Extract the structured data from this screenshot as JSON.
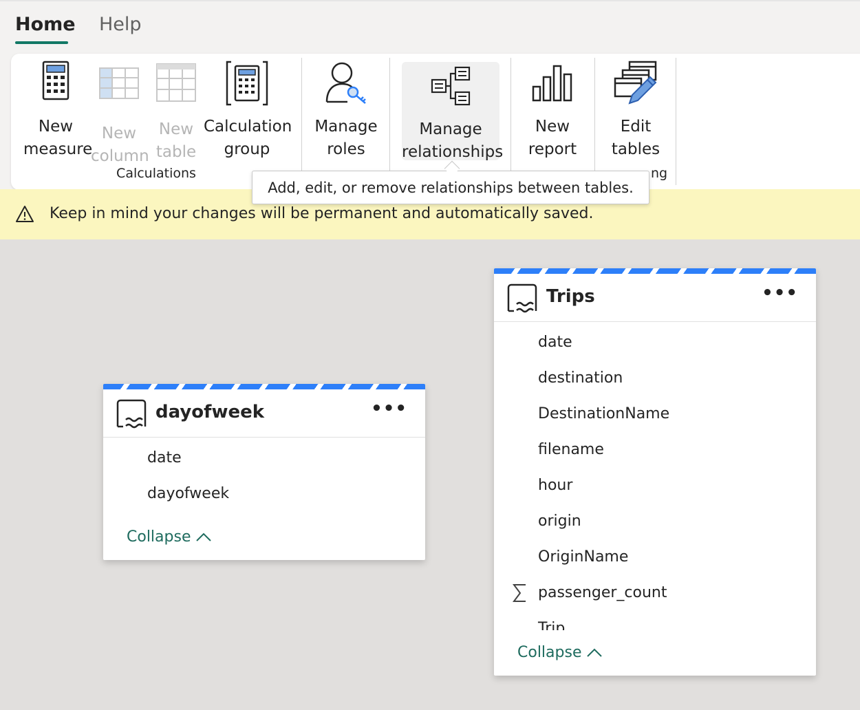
{
  "tabs": [
    {
      "label": "Home",
      "active": true
    },
    {
      "label": "Help",
      "active": false
    }
  ],
  "ribbon": {
    "new_measure": "New measure",
    "new_measure_l1": "New",
    "new_measure_l2": "measure",
    "new_column_l1": "New",
    "new_column_l2": "column",
    "new_table_l1": "New",
    "new_table_l2": "table",
    "calc_group_l1": "Calculation",
    "calc_group_l2": "group",
    "manage_roles_l1": "Manage",
    "manage_roles_l2": "roles",
    "manage_rel_l1": "Manage",
    "manage_rel_l2": "relationships",
    "new_report_l1": "New",
    "new_report_l2": "report",
    "edit_tables_l1": "Edit",
    "edit_tables_l2": "tables",
    "group_calculations": "Calculations",
    "group_modeling_partial": "ng"
  },
  "tooltip": "Add, edit, or remove relationships between tables.",
  "warning": "Keep in mind your changes will be permanent and automatically saved.",
  "tables": {
    "dayofweek": {
      "title": "dayofweek",
      "more": "•••",
      "fields": [
        "date",
        "dayofweek"
      ],
      "collapse": "Collapse"
    },
    "trips": {
      "title": "Trips",
      "more": "•••",
      "fields": [
        "date",
        "destination",
        "DestinationName",
        "filename",
        "hour",
        "origin",
        "OriginName",
        "passenger_count",
        "Trip"
      ],
      "sigma_field": "passenger_count",
      "collapse": "Collapse"
    }
  },
  "colors": {
    "accent": "#117865",
    "stripe": "#2d7ff9",
    "warning_bg": "#fbf6bf",
    "canvas": "#e1dfdd"
  }
}
